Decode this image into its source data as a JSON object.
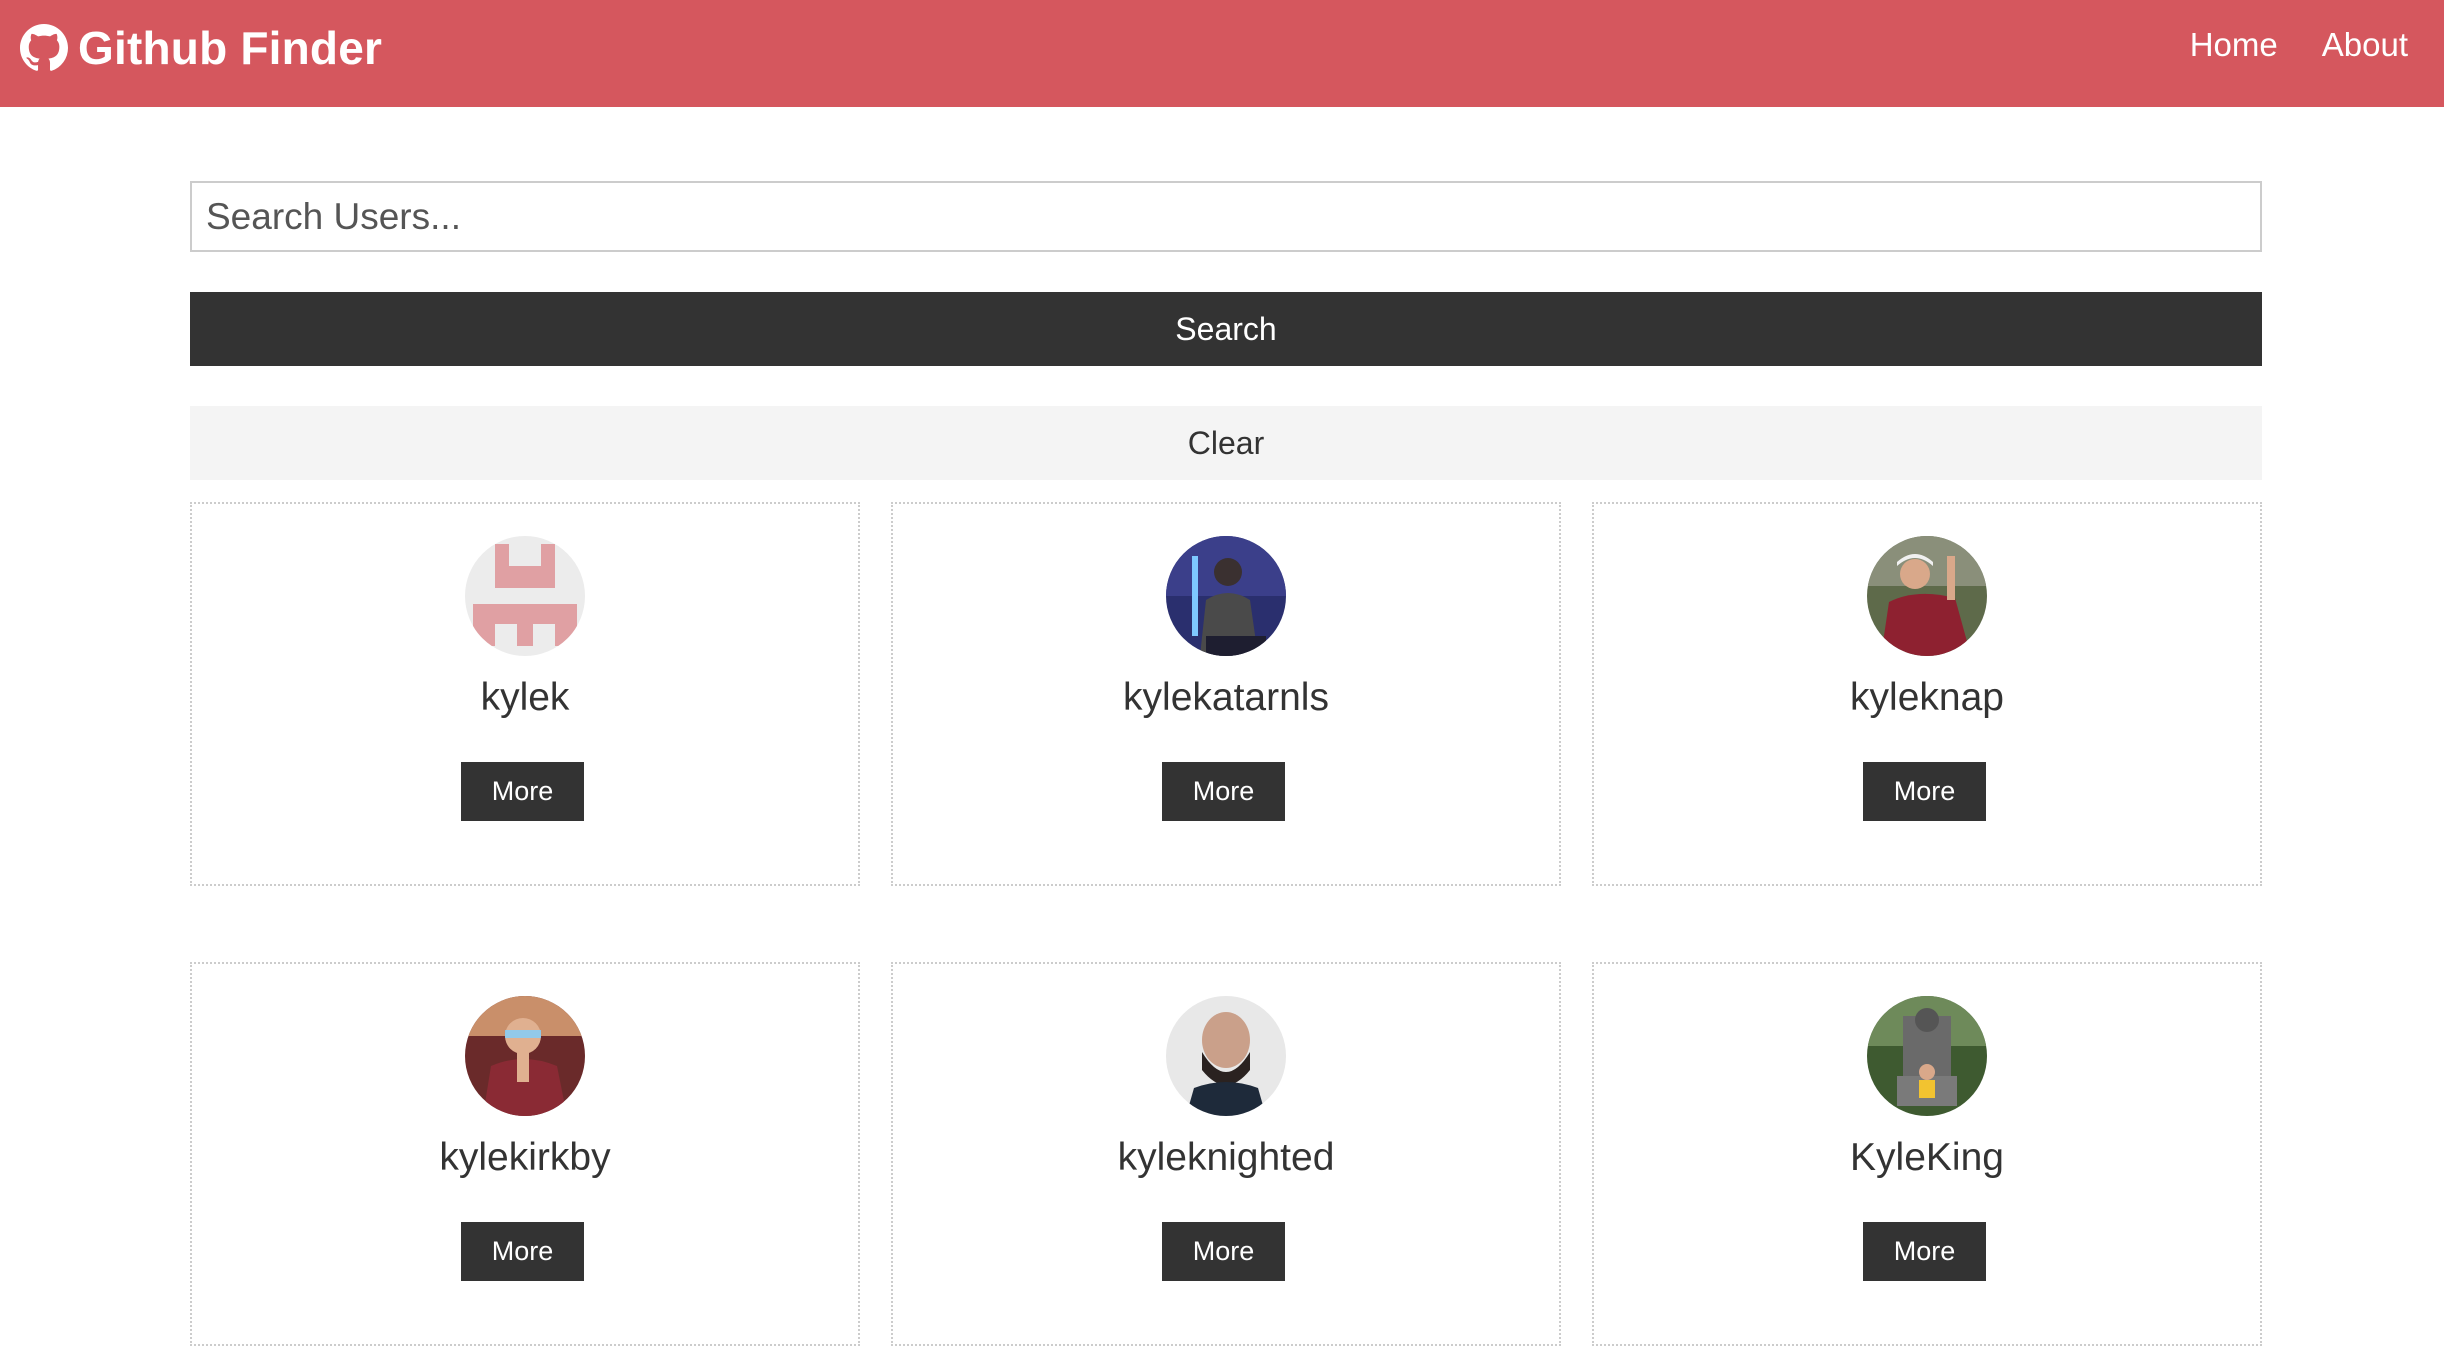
{
  "navbar": {
    "brand_icon": "github-icon",
    "title": "Github Finder",
    "background_color": "#d5575e",
    "links": [
      {
        "label": "Home"
      },
      {
        "label": "About"
      }
    ]
  },
  "search": {
    "placeholder": "Search Users...",
    "value": "",
    "search_label": "Search",
    "clear_label": "Clear"
  },
  "users": [
    {
      "login": "kylek",
      "avatar": "identicon-avatar",
      "more_label": "More"
    },
    {
      "login": "kylekatarnls",
      "avatar": "photo-avatar",
      "more_label": "More"
    },
    {
      "login": "kyleknap",
      "avatar": "photo-avatar",
      "more_label": "More"
    },
    {
      "login": "kylekirkby",
      "avatar": "photo-avatar",
      "more_label": "More"
    },
    {
      "login": "kyleknighted",
      "avatar": "photo-avatar",
      "more_label": "More"
    },
    {
      "login": "KyleKing",
      "avatar": "photo-avatar",
      "more_label": "More"
    }
  ]
}
